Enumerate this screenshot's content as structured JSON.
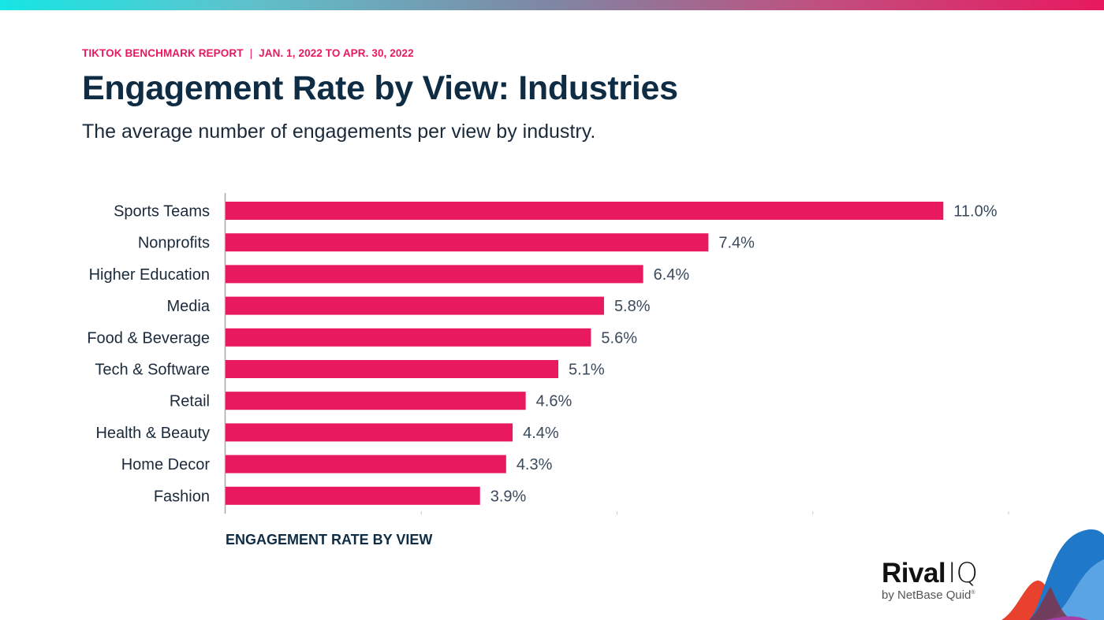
{
  "header": {
    "report_name": "TIKTOK BENCHMARK REPORT",
    "separator": "|",
    "date_range": "JAN. 1, 2022 TO APR. 30, 2022",
    "title": "Engagement Rate by View: Industries",
    "subtitle": "The average number of engagements per view by industry."
  },
  "colors": {
    "bar": "#e8195f",
    "title": "#0f2c45",
    "accent": "#e8195f"
  },
  "chart_data": {
    "type": "bar",
    "orientation": "horizontal",
    "title": "Engagement Rate by View: Industries",
    "xlabel": "ENGAGEMENT RATE BY VIEW",
    "ylabel": "",
    "categories": [
      "Sports Teams",
      "Nonprofits",
      "Higher Education",
      "Media",
      "Food & Beverage",
      "Tech & Software",
      "Retail",
      "Health & Beauty",
      "Home Decor",
      "Fashion"
    ],
    "values": [
      11.0,
      7.4,
      6.4,
      5.8,
      5.6,
      5.1,
      4.6,
      4.4,
      4.3,
      3.9
    ],
    "value_labels": [
      "11.0%",
      "7.4%",
      "6.4%",
      "5.8%",
      "5.6%",
      "5.1%",
      "4.6%",
      "4.4%",
      "4.3%",
      "3.9%"
    ],
    "unit": "%",
    "xlim": [
      0,
      12
    ],
    "xticks": [
      0,
      3,
      6,
      9,
      12
    ],
    "xtick_labels_shown": false,
    "grid": false,
    "legend": "none"
  },
  "branding": {
    "logo_primary": "Rival",
    "logo_secondary": "IQ",
    "logo_tagline": "by NetBase Quid",
    "registered_mark": "®"
  }
}
